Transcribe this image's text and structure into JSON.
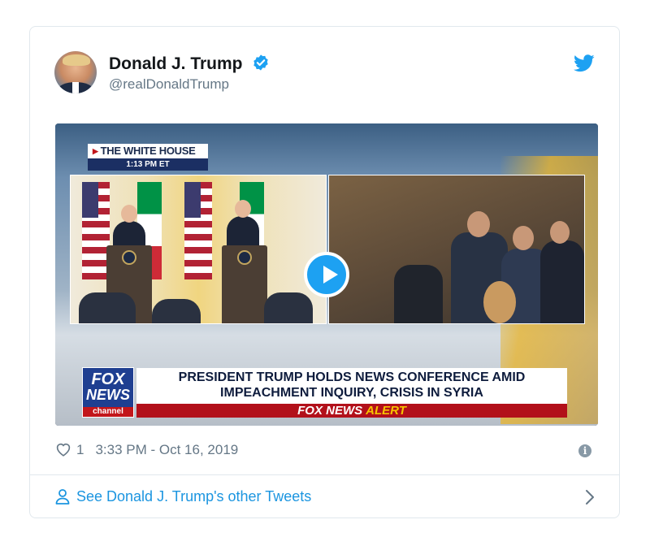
{
  "tweet": {
    "author_name": "Donald J. Trump",
    "author_handle": "@realDonaldTrump",
    "verified": true,
    "likes": "1",
    "timestamp": "3:33 PM - Oct 16, 2019",
    "footer_link": "See Donald J. Trump's other Tweets"
  },
  "video": {
    "location_tag": "THE WHITE HOUSE",
    "time_tag": "1:13 PM ET",
    "logo_line1": "FOX",
    "logo_line2": "NEWS",
    "logo_line3": "channel",
    "headline_line1": "PRESIDENT TRUMP HOLDS NEWS CONFERENCE AMID",
    "headline_line2": "IMPEACHMENT INQUIRY, CRISIS IN SYRIA",
    "alert_brand": "FOX NEWS",
    "alert_word": "ALERT"
  },
  "icons": {
    "brand": "twitter-bird-icon",
    "verified": "verified-badge-icon",
    "like": "heart-icon",
    "info": "info-icon",
    "play": "play-icon",
    "person": "person-icon",
    "chevron": "chevron-right-icon"
  },
  "colors": {
    "twitter_blue": "#1da1f2",
    "link_blue": "#1b95e0",
    "text_primary": "#14171a",
    "text_secondary": "#657786",
    "fox_red": "#b2101a",
    "fox_navy": "#1f3f91",
    "alert_yellow": "#f6c400"
  }
}
